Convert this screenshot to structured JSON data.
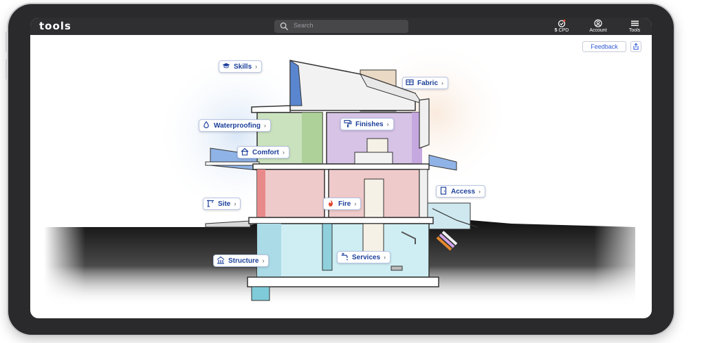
{
  "app": {
    "logo": "tools"
  },
  "search": {
    "placeholder": "Search"
  },
  "nav": {
    "cpd": {
      "label": "CPD",
      "count": "5"
    },
    "account": {
      "label": "Account"
    },
    "tools": {
      "label": "Tools"
    }
  },
  "actions": {
    "feedback": "Feedback"
  },
  "categories": {
    "skills": "Skills",
    "fabric": "Fabric",
    "waterproofing": "Waterproofing",
    "finishes": "Finishes",
    "comfort": "Comfort",
    "access": "Access",
    "site": "Site",
    "fire": "Fire",
    "structure": "Structure",
    "services": "Services"
  },
  "colors": {
    "accent": "#2f5bd6",
    "fire_icon": "#e2452e",
    "topbar": "#2f2f31"
  },
  "icons": {
    "skills": "graduation-cap-icon",
    "fabric": "window-icon",
    "waterproofing": "droplet-icon",
    "finishes": "paint-roller-icon",
    "comfort": "home-icon",
    "access": "door-icon",
    "site": "crane-icon",
    "fire": "flame-icon",
    "structure": "building-icon",
    "services": "water-tap-icon"
  }
}
